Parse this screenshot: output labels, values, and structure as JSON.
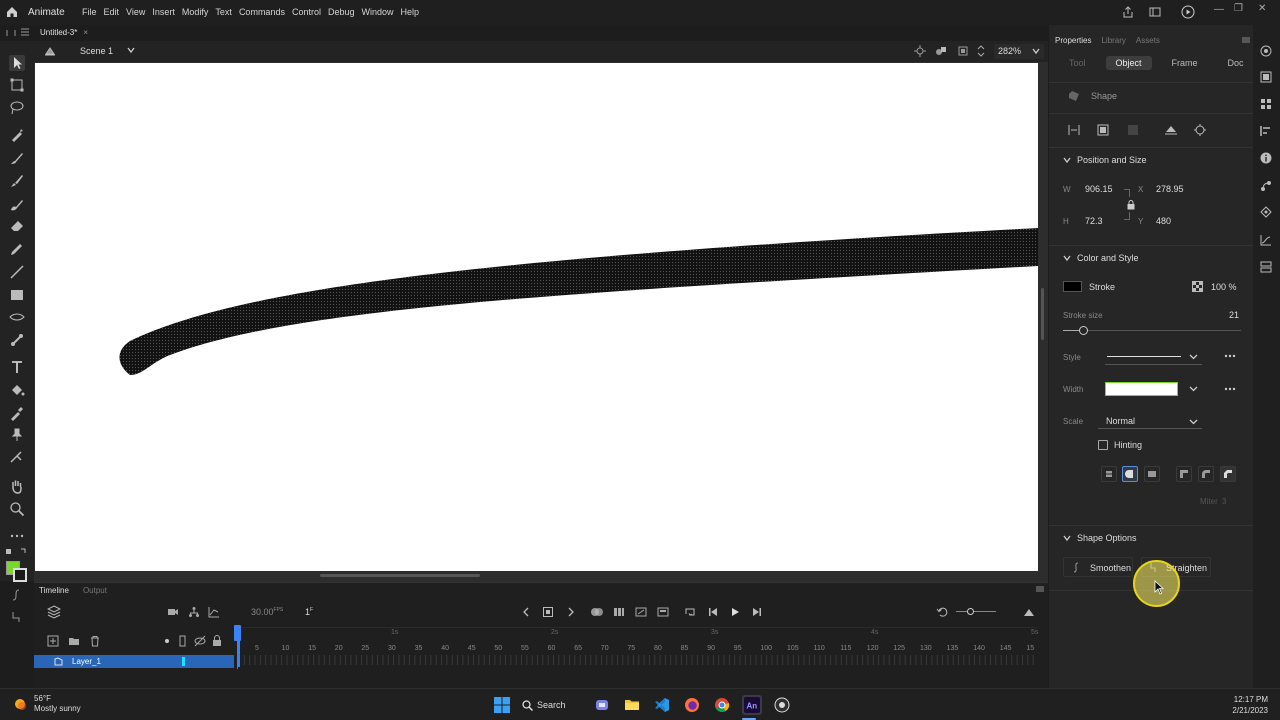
{
  "app": {
    "name": "Animate"
  },
  "menu": [
    "File",
    "Edit",
    "View",
    "Insert",
    "Modify",
    "Text",
    "Commands",
    "Control",
    "Debug",
    "Window",
    "Help"
  ],
  "document": {
    "tab_title": "Untitled-3*",
    "close": "×"
  },
  "scene": {
    "label": "Scene 1",
    "zoom": "282%"
  },
  "timeline": {
    "tabs": [
      "Timeline",
      "Output"
    ],
    "fps": "30.00",
    "fps_unit": "FPS",
    "frame": "1",
    "frame_unit": "F",
    "layer_name": "Layer_1",
    "ruler_labels": [
      "5",
      "10",
      "15",
      "20",
      "25",
      "30",
      "35",
      "40",
      "45",
      "50",
      "55",
      "60",
      "65",
      "70",
      "75",
      "80",
      "85",
      "90",
      "95",
      "100",
      "105",
      "110",
      "115",
      "120",
      "125",
      "130",
      "135",
      "140",
      "145",
      "15"
    ],
    "second_markers": [
      "1s",
      "2s",
      "3s",
      "4s",
      "5s"
    ]
  },
  "properties": {
    "panel_tabs": [
      "Properties",
      "Library",
      "Assets"
    ],
    "sub_tabs": [
      "Tool",
      "Object",
      "Frame",
      "Doc"
    ],
    "object_type": "Shape",
    "position_size": {
      "header": "Position and Size",
      "w_label": "W",
      "w": "906.15",
      "h_label": "H",
      "h": "72.3",
      "x_label": "X",
      "x": "278.95",
      "y_label": "Y",
      "y": "480"
    },
    "color_style": {
      "header": "Color and Style",
      "stroke_label": "Stroke",
      "stroke_color": "#000000",
      "opacity": "100 %",
      "stroke_size_label": "Stroke size",
      "stroke_size": "21",
      "stroke_slider_fraction": 0.11,
      "style_label": "Style",
      "width_label": "Width",
      "scale_label": "Scale",
      "scale_value": "Normal",
      "hinting_label": "Hinting",
      "miter_label": "Miter",
      "miter_value": "3"
    },
    "shape_options": {
      "header": "Shape Options",
      "smoothen": "Smoothen",
      "straighten": "Straighten"
    }
  },
  "taskbar": {
    "temperature": "56°F",
    "weather": "Mostly sunny",
    "search": "Search",
    "time": "12:17 PM",
    "date": "2/21/2023"
  },
  "colors": {
    "accent_blue": "#2a66b8",
    "fill_green": "#7ad82b",
    "cursor_highlight": "#f4e84a"
  }
}
